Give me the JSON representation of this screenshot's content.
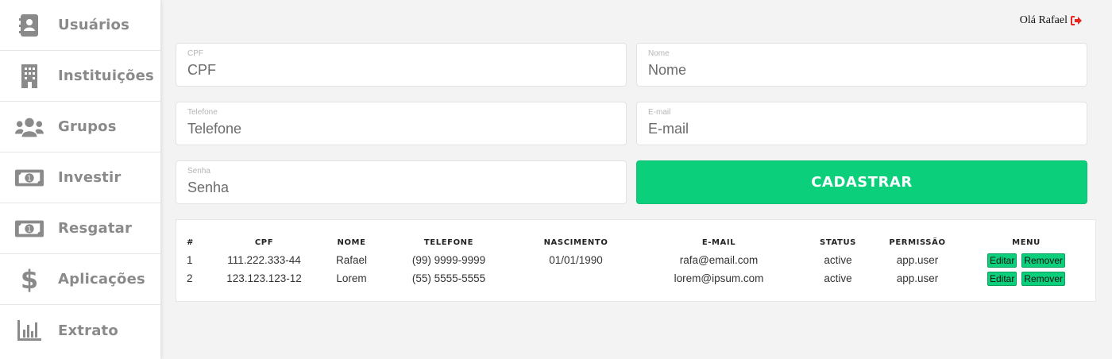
{
  "sidebar": {
    "items": [
      {
        "label": "Usuários",
        "icon": "address-book-icon"
      },
      {
        "label": "Instituições",
        "icon": "building-icon"
      },
      {
        "label": "Grupos",
        "icon": "users-icon"
      },
      {
        "label": "Investir",
        "icon": "money-bill-icon"
      },
      {
        "label": "Resgatar",
        "icon": "money-bill-icon"
      },
      {
        "label": "Aplicações",
        "icon": "dollar-sign-icon"
      },
      {
        "label": "Extrato",
        "icon": "bar-chart-icon"
      }
    ]
  },
  "header": {
    "greeting": "Olá Rafael",
    "logout_icon": "sign-out-icon",
    "logout_color": "#e8251f"
  },
  "form": {
    "cpf": {
      "label": "CPF",
      "placeholder": "CPF",
      "value": ""
    },
    "nome": {
      "label": "Nome",
      "placeholder": "Nome",
      "value": ""
    },
    "telefone": {
      "label": "Telefone",
      "placeholder": "Telefone",
      "value": ""
    },
    "email": {
      "label": "E-mail",
      "placeholder": "E-mail",
      "value": ""
    },
    "senha": {
      "label": "Senha",
      "placeholder": "Senha",
      "value": ""
    },
    "submit_label": "CADASTRAR"
  },
  "table": {
    "headers": [
      "#",
      "CPF",
      "NOME",
      "TELEFONE",
      "NASCIMENTO",
      "E-MAIL",
      "STATUS",
      "PERMISSÃO",
      "MENU"
    ],
    "rows": [
      {
        "num": "1",
        "cpf": "111.222.333-44",
        "nome": "Rafael",
        "telefone": "(99) 9999-9999",
        "nascimento": "01/01/1990",
        "email": "rafa@email.com",
        "status": "active",
        "permissao": "app.user"
      },
      {
        "num": "2",
        "cpf": "123.123.123-12",
        "nome": "Lorem",
        "telefone": "(55) 5555-5555",
        "nascimento": "",
        "email": "lorem@ipsum.com",
        "status": "active",
        "permissao": "app.user"
      }
    ],
    "edit_label": "Editar",
    "remove_label": "Remover"
  },
  "colors": {
    "accent": "#0ccf7c",
    "sidebar_text": "#8a8a8a",
    "background": "#f3f3f3"
  }
}
